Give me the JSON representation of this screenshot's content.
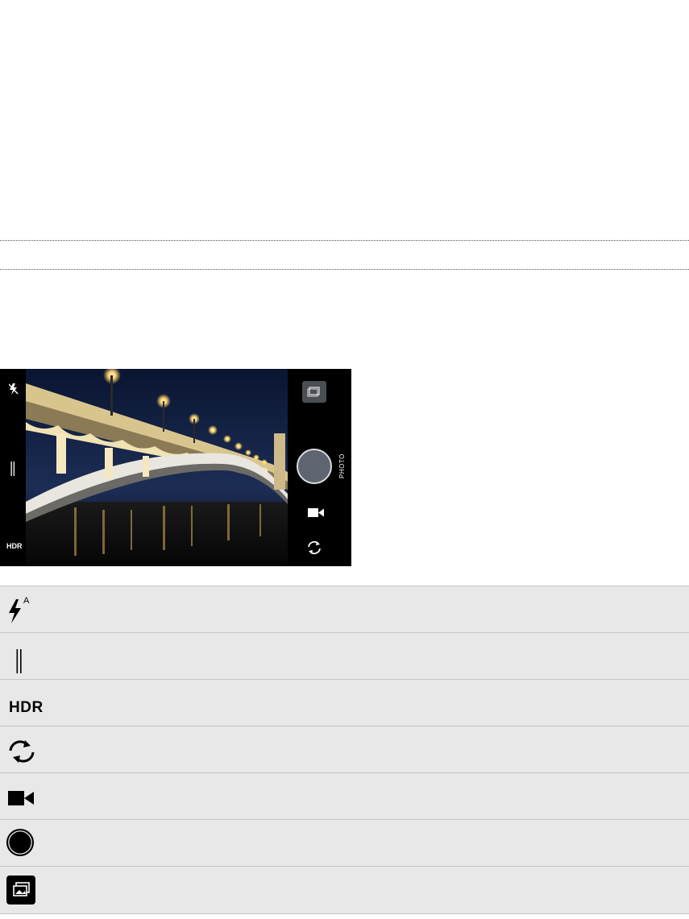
{
  "camera_screen": {
    "mode_label": "PHOTO",
    "left_bar_icons": [
      "flash-off-icon",
      "tone-slider-icon",
      "hdr-icon"
    ],
    "hdr_label": "HDR",
    "right_bar_icons": [
      "gallery-icon",
      "shutter-button",
      "video-icon",
      "switch-camera-icon"
    ]
  },
  "legend": {
    "rows": [
      {
        "icon": "flash-auto-icon",
        "superscript": "A"
      },
      {
        "icon": "tone-slider-icon"
      },
      {
        "icon": "hdr-icon",
        "label": "HDR"
      },
      {
        "icon": "switch-camera-icon"
      },
      {
        "icon": "video-icon"
      },
      {
        "icon": "shutter-icon"
      },
      {
        "icon": "gallery-icon"
      }
    ]
  },
  "colors": {
    "row_background": "#e8e8e8",
    "row_border": "#c4c4c4",
    "camera_bar": "#000000",
    "shutter_fill": "#5f6570"
  }
}
